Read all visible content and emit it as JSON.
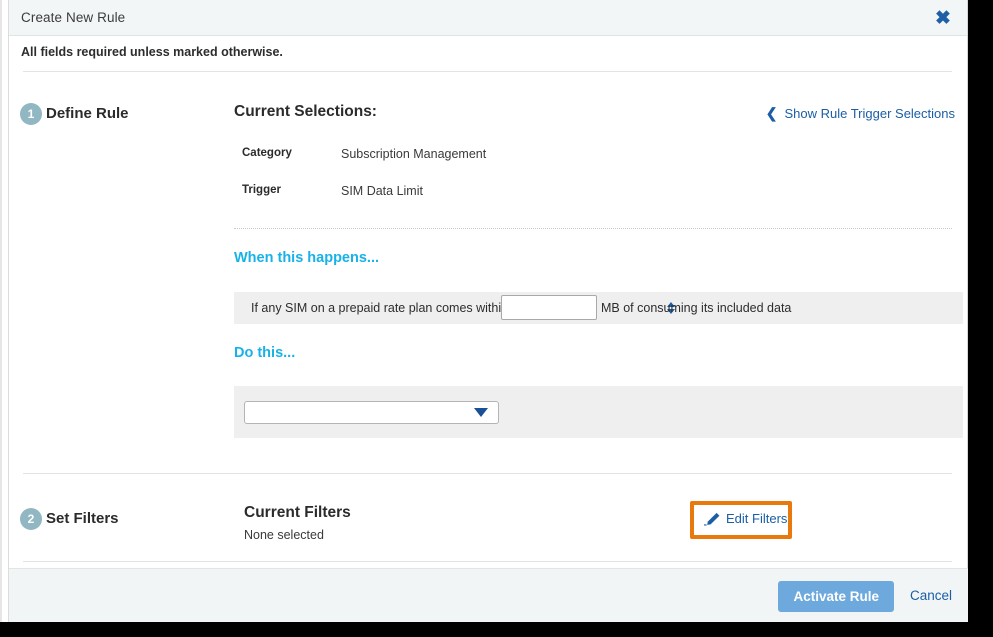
{
  "dialog": {
    "title": "Create New Rule",
    "close_icon": "close-icon",
    "required_note": "All fields required unless marked otherwise."
  },
  "steps": [
    {
      "number": "1",
      "label": "Define Rule"
    },
    {
      "number": "2",
      "label": "Set Filters"
    }
  ],
  "define_rule": {
    "current_selections_title": "Current Selections:",
    "show_trigger_link": "Show Rule Trigger Selections",
    "chevron_icon": "chevron-left-icon",
    "selections": [
      {
        "key": "Category",
        "value": "Subscription Management"
      },
      {
        "key": "Trigger",
        "value": "SIM Data Limit"
      }
    ],
    "when_heading": "When this happens...",
    "when_text_before": "If any SIM on a prepaid rate plan comes within",
    "when_text_after": "MB of consuming its included data",
    "threshold_value": "",
    "threshold_placeholder": "",
    "spinner_up_icon": "triangle-up-icon",
    "spinner_down_icon": "triangle-down-icon",
    "do_heading": "Do this...",
    "action_value": "",
    "action_caret_icon": "triangle-down-icon"
  },
  "set_filters": {
    "current_filters_title": "Current Filters",
    "current_filters_value": "None selected",
    "edit_filters_label": "Edit Filters",
    "edit_icon": "pencil-icon",
    "highlight_color": "#e8790c"
  },
  "footer": {
    "primary_label": "Activate Rule",
    "cancel_label": "Cancel"
  },
  "colors": {
    "accent_cyan": "#18b2e8",
    "link_blue": "#1b5ea6",
    "step_badge": "#91b7c3",
    "primary_button": "#6ea9dd",
    "annotation_orange": "#e8790c"
  }
}
